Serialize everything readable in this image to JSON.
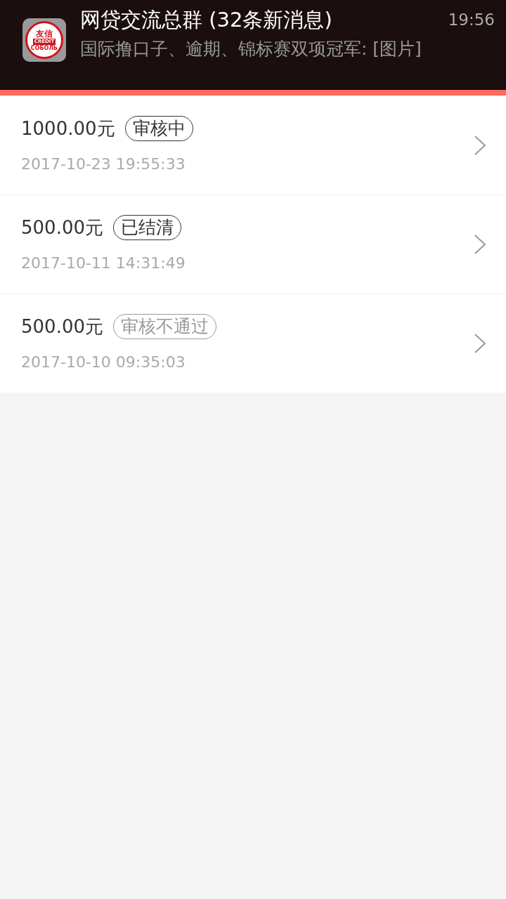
{
  "notification": {
    "app_logo": {
      "name": "友信",
      "label": "CREDIT",
      "ribbon": "СОБОЛЬ"
    },
    "title": "网贷交流总群 (32条新消息)",
    "message": "国际撸口子、逾期、锦标赛双项冠军: [图片]",
    "time": "19:56"
  },
  "records": [
    {
      "amount": "1000.00元",
      "status": "审核中",
      "muted": false,
      "date": "2017-10-23 19:55:33"
    },
    {
      "amount": "500.00元",
      "status": "已结清",
      "muted": false,
      "date": "2017-10-11 14:31:49"
    },
    {
      "amount": "500.00元",
      "status": "审核不通过",
      "muted": true,
      "date": "2017-10-10 09:35:03"
    }
  ]
}
